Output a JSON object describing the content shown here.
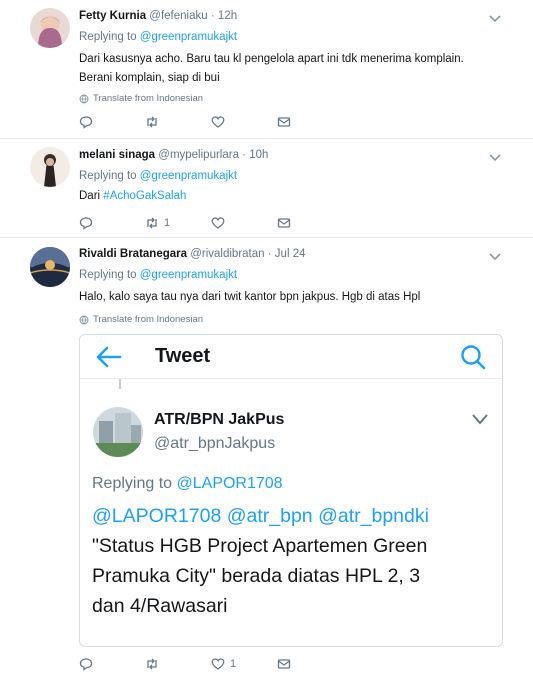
{
  "tweets": [
    {
      "name": "Fetty Kurnia",
      "handle": "@fefeniaku",
      "time": "12h",
      "replying_prefix": "Replying to",
      "replying_to": "@greenpramukajkt",
      "text_lines": [
        "Dari kasusnya acho. Baru tau kl pengelola apart ini tdk menerima komplain.",
        "Berani komplain, siap di bui"
      ],
      "translate": "Translate from Indonesian",
      "retweets": "",
      "likes": ""
    },
    {
      "name": "melani sinaga",
      "handle": "@mypelipurlara",
      "time": "10h",
      "replying_prefix": "Replying to",
      "replying_to": "@greenpramukajkt",
      "text_prefix": "Dari",
      "hashtag": "#AchoGakSalah",
      "retweets": "1",
      "likes": ""
    },
    {
      "name": "Rivaldi Bratanegara",
      "handle": "@rivaldibratan",
      "time": "Jul 24",
      "replying_prefix": "Replying to",
      "replying_to": "@greenpramukajkt",
      "text_lines": [
        "Halo, kalo saya tau nya dari twit kantor bpn jakpus. Hgb di atas Hpl"
      ],
      "translate": "Translate from Indonesian",
      "retweets": "",
      "likes": "1"
    }
  ],
  "embed": {
    "header_title": "Tweet",
    "name": "ATR/BPN JakPus",
    "handle": "@atr_bpnJakpus",
    "replying_prefix": "Replying to",
    "replying_to": "@LAPOR1708",
    "mentions": [
      "@LAPOR1708",
      "@atr_bpn",
      "@atr_bpndki"
    ],
    "text_lines": [
      "\"Status HGB Project Apartemen Green",
      "Pramuka City\" berada diatas HPL 2, 3",
      "dan 4/Rawasari"
    ]
  },
  "colors": {
    "accent": "#1da1f2",
    "muted": "#657786",
    "text": "#14171a",
    "divider": "#e6ecf0"
  },
  "icons": [
    "reply-icon",
    "retweet-icon",
    "like-icon",
    "dm-icon",
    "globe-icon",
    "chevron-down-icon",
    "back-arrow-icon",
    "search-icon"
  ]
}
